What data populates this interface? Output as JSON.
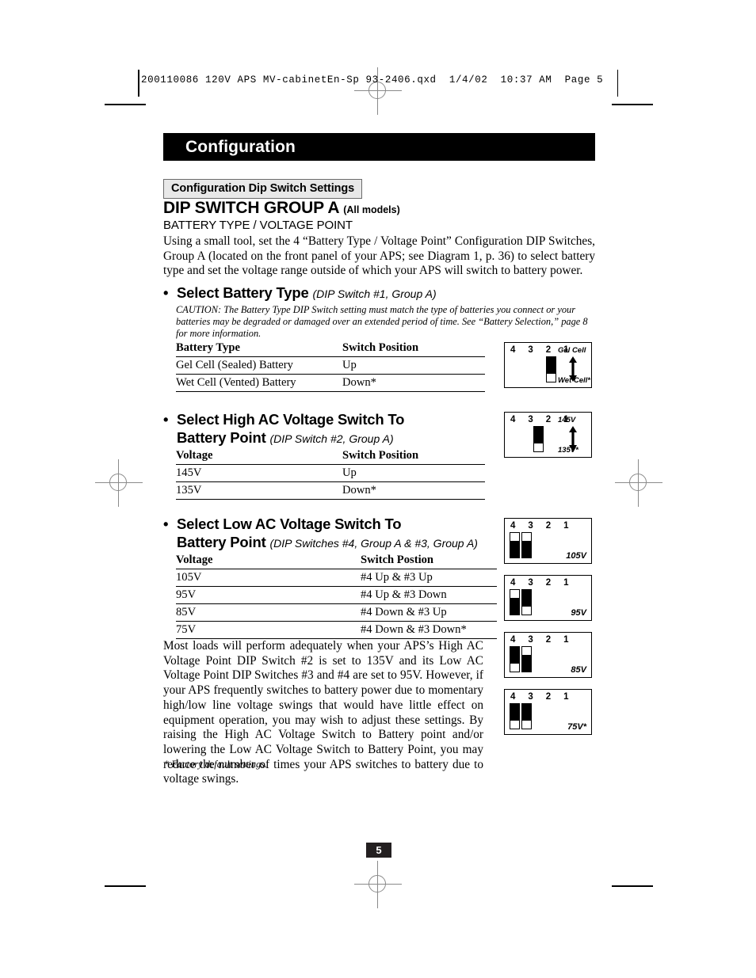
{
  "slug": {
    "text": "200110086 120V APS MV-cabinetEn-Sp 93-2406.qxd  1/4/02  10:37 AM  Page 5"
  },
  "chapter": {
    "title": "Configuration"
  },
  "subhead": {
    "label": "Configuration Dip Switch Settings"
  },
  "group": {
    "title": "DIP SWITCH GROUP A",
    "title_qualifier": "(All models)",
    "subtitle": "BATTERY TYPE / VOLTAGE POINT",
    "intro": "Using a small tool, set the 4 “Battery Type / Voltage Point” Configuration DIP Switches, Group A (located on the front panel of your APS; see Diagram 1, p. 36) to select battery type and set the voltage range outside of which your APS will switch to battery power."
  },
  "sections": [
    {
      "heading": "Select Battery Type",
      "qualifier": "(DIP Switch #1, Group A)",
      "caution": "CAUTION: The Battery Type DIP Switch setting must match the type of batteries you connect or your batteries may be degraded or damaged over an extended period of time. See “Battery Selection,” page 8 for more information.",
      "table": {
        "headers": [
          "Battery Type",
          "Switch Position"
        ],
        "rows": [
          [
            "Gel Cell (Sealed) Battery",
            "Up"
          ],
          [
            "Wet Cell (Vented) Battery",
            "Down*"
          ]
        ]
      }
    },
    {
      "heading_line1": "Select High AC Voltage Switch To",
      "heading_line2": "Battery Point",
      "qualifier": "(DIP Switch #2, Group A)",
      "table": {
        "headers": [
          "Voltage",
          "Switch Position"
        ],
        "rows": [
          [
            "145V",
            "Up"
          ],
          [
            "135V",
            "Down*"
          ]
        ]
      }
    },
    {
      "heading_line1": "Select Low AC Voltage Switch To",
      "heading_line2": "Battery Point",
      "qualifier": "(DIP Switches #4, Group A & #3, Group A)",
      "table": {
        "headers": [
          "Voltage",
          "Switch Postion"
        ],
        "rows": [
          [
            "105V",
            "#4 Up & #3 Up"
          ],
          [
            "95V",
            "#4 Up & #3 Down"
          ],
          [
            "85V",
            "#4 Down & #3 Up"
          ],
          [
            "75V",
            "#4 Down & #3 Down*"
          ]
        ]
      }
    }
  ],
  "diagrams": [
    {
      "name": "battery-type",
      "numbers": "4 3 2 1",
      "label_top": "Gel Cell",
      "label_bottom": "Wet Cell*",
      "has_arrow": true,
      "switches": [
        {
          "slot": 1,
          "position": "up"
        }
      ]
    },
    {
      "name": "high-ac-voltage",
      "numbers": "4 3 2 1",
      "label_top": "145V",
      "label_bottom": "135V*",
      "has_arrow": true,
      "switches": [
        {
          "slot": 2,
          "position": "up"
        }
      ]
    },
    {
      "name": "low-ac-105v",
      "numbers": "4 3 2 1",
      "label_corner": "105V",
      "has_arrow": false,
      "switches": [
        {
          "slot": 4,
          "position": "down"
        },
        {
          "slot": 3,
          "position": "down"
        }
      ]
    },
    {
      "name": "low-ac-95v",
      "numbers": "4 3 2 1",
      "label_corner": "95V",
      "has_arrow": false,
      "switches": [
        {
          "slot": 4,
          "position": "down"
        },
        {
          "slot": 3,
          "position": "up"
        }
      ]
    },
    {
      "name": "low-ac-85v",
      "numbers": "4 3 2 1",
      "label_corner": "85V",
      "has_arrow": false,
      "switches": [
        {
          "slot": 4,
          "position": "up"
        },
        {
          "slot": 3,
          "position": "down"
        }
      ]
    },
    {
      "name": "low-ac-75v",
      "numbers": "4 3 2 1",
      "label_corner": "75V*",
      "has_arrow": false,
      "switches": [
        {
          "slot": 4,
          "position": "up"
        },
        {
          "slot": 3,
          "position": "up"
        }
      ]
    }
  ],
  "closing_paragraph": "Most loads will perform adequately when your APS’s High AC Voltage Point DIP Switch #2 is set to 135V and its Low AC Voltage Point DIP Switches #3 and #4 are set to 95V. However, if your APS frequently switches to battery power due to momentary high/low line voltage swings that would have little effect on equipment operation, you may wish to adjust these settings. By raising the High AC Voltage Switch to Battery point and/or lowering the Low AC Voltage Switch to Battery Point, you may reduce the number of times your APS switches to battery due to voltage swings.",
  "footnote": "* Factory default settings.",
  "page_number": "5"
}
